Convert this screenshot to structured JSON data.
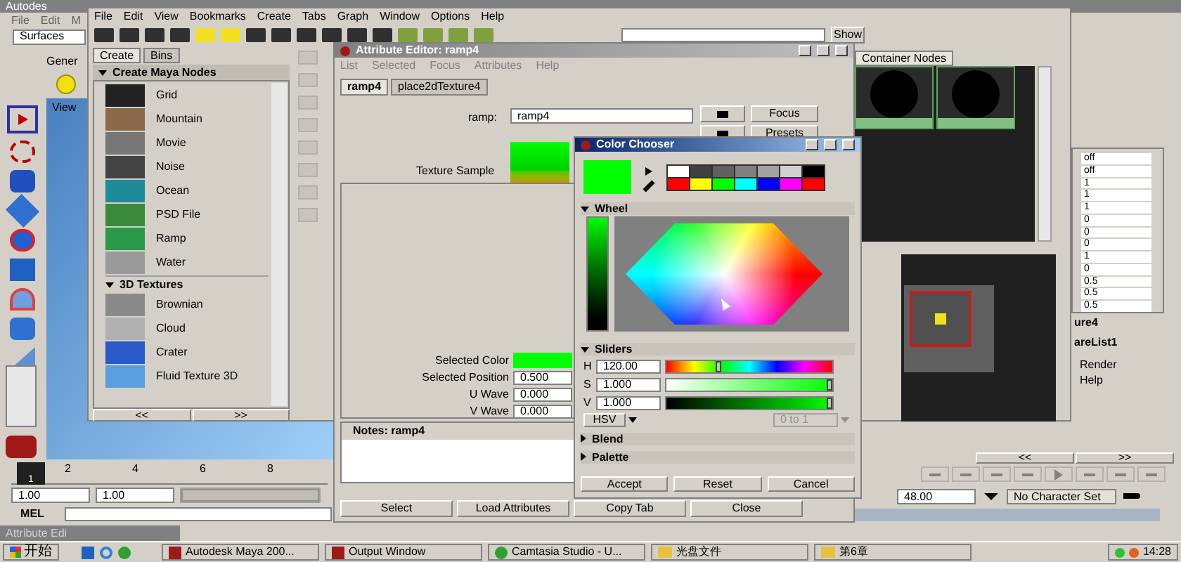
{
  "maya": {
    "title": "Autodes",
    "menu": [
      "File",
      "Edit",
      "M"
    ],
    "shelf_menu": "Surfaces",
    "shelf_tab": "Gener",
    "view_label": "View",
    "timeline_ticks": [
      "2",
      "4",
      "6",
      "8"
    ],
    "current_frame": "1",
    "range_fields": [
      "1.00",
      "1.00"
    ],
    "time_slider": {
      "level": 0
    },
    "range_slider": {
      "level": 1
    },
    "command_label": "MEL",
    "channel_values": [
      "off",
      "off",
      "1",
      "1",
      "1",
      "0",
      "0",
      "0",
      "1",
      "0",
      "0.5",
      "0.5",
      "0.5"
    ],
    "layer_labels": [
      "ure4",
      "areList1"
    ],
    "layer_menu": [
      "Render",
      "Help"
    ],
    "pager": [
      "<<",
      ">>"
    ],
    "end_time": "48.00",
    "character_set": "No Character Set",
    "minimized_window": "Attribute Edi"
  },
  "hypershade": {
    "menu": [
      "File",
      "Edit",
      "View",
      "Bookmarks",
      "Create",
      "Tabs",
      "Graph",
      "Window",
      "Options",
      "Help"
    ],
    "panel_tabs": [
      {
        "label": "Create",
        "selected": true
      },
      {
        "label": "Bins",
        "selected": false
      }
    ],
    "panel_header": "Create Maya Nodes",
    "nodes": [
      {
        "kind": "item",
        "label": "Grid",
        "color": "#222222"
      },
      {
        "kind": "item",
        "label": "Mountain",
        "color": "#8a6a4a"
      },
      {
        "kind": "item",
        "label": "Movie",
        "color": "#777777"
      },
      {
        "kind": "item",
        "label": "Noise",
        "color": "#444444"
      },
      {
        "kind": "item",
        "label": "Ocean",
        "color": "#1e8a9a"
      },
      {
        "kind": "item",
        "label": "PSD File",
        "color": "#3a8a3a"
      },
      {
        "kind": "item",
        "label": "Ramp",
        "color": "#2a9a4a"
      },
      {
        "kind": "item",
        "label": "Water",
        "color": "#9a9a9a"
      },
      {
        "kind": "section",
        "label": "3D Textures",
        "expanded": true
      },
      {
        "kind": "item",
        "label": "Brownian",
        "color": "#8a8a8a"
      },
      {
        "kind": "item",
        "label": "Cloud",
        "color": "#b0b0b0"
      },
      {
        "kind": "item",
        "label": "Crater",
        "color": "#2a5ac8"
      },
      {
        "kind": "item",
        "label": "Fluid Texture 3D",
        "color": "#5aa0e0"
      }
    ],
    "pager": [
      "<<",
      ">>"
    ],
    "show_button": "Show",
    "work_tab": "Container Nodes"
  },
  "attribute_editor": {
    "title": "Attribute Editor: ramp4",
    "menu": [
      "List",
      "Selected",
      "Focus",
      "Attributes",
      "Help"
    ],
    "tabs": [
      {
        "label": "ramp4",
        "selected": true
      },
      {
        "label": "place2dTexture4",
        "selected": false
      }
    ],
    "node_label": "ramp:",
    "node_name": "ramp4",
    "side_buttons": [
      "Focus",
      "Presets"
    ],
    "sample_label": "Texture Sample",
    "fields": [
      {
        "kind": "color",
        "label": "Selected Color",
        "color": "#00ff00"
      },
      {
        "kind": "number",
        "label": "Selected Position",
        "value": "0.500"
      },
      {
        "kind": "number",
        "label": "U Wave",
        "value": "0.000"
      },
      {
        "kind": "number",
        "label": "V Wave",
        "value": "0.000"
      }
    ],
    "notes_label": "Notes:  ramp4",
    "buttons": [
      "Select",
      "Load Attributes",
      "Copy Tab",
      "Close"
    ]
  },
  "color_chooser": {
    "title": "Color Chooser",
    "swatches": [
      {
        "color": "#ffffff"
      },
      {
        "color": "#404040"
      },
      {
        "color": "#606060"
      },
      {
        "color": "#808080"
      },
      {
        "color": "#a0a0a0"
      },
      {
        "color": "#d0d0d0"
      },
      {
        "color": "#000000"
      },
      {
        "color": "#ff0000"
      },
      {
        "color": "#ffff00"
      },
      {
        "color": "#00ff00"
      },
      {
        "color": "#00ffff"
      },
      {
        "color": "#0000ff"
      },
      {
        "color": "#ff00ff"
      },
      {
        "color": "#ff0000"
      }
    ],
    "wheel": {
      "title": "Wheel",
      "expanded": true
    },
    "sliders": {
      "title": "Sliders",
      "expanded": true,
      "rows": [
        {
          "label": "H",
          "value": "120.00",
          "level": 0.333,
          "kind": "hue"
        },
        {
          "label": "S",
          "value": "1.000",
          "level": 1,
          "kind": "saturation"
        },
        {
          "label": "V",
          "value": "1.000",
          "level": 1,
          "kind": "value"
        }
      ],
      "mode": "HSV",
      "range": "0 to 1"
    },
    "collapsed_sections": [
      {
        "title": "Blend",
        "expanded": false
      },
      {
        "title": "Palette",
        "expanded": false
      }
    ],
    "buttons": [
      "Accept",
      "Reset",
      "Cancel"
    ]
  },
  "taskbar": {
    "start": "开始",
    "items": [
      {
        "label": "Autodesk Maya 200...",
        "kind": "app"
      },
      {
        "label": "Output Window",
        "kind": "app"
      },
      {
        "label": "Camtasia Studio - U...",
        "kind": "recorder"
      },
      {
        "label": "光盘文件",
        "kind": "folder"
      },
      {
        "label": "第6章",
        "kind": "folder"
      }
    ],
    "clock": "14:28"
  }
}
